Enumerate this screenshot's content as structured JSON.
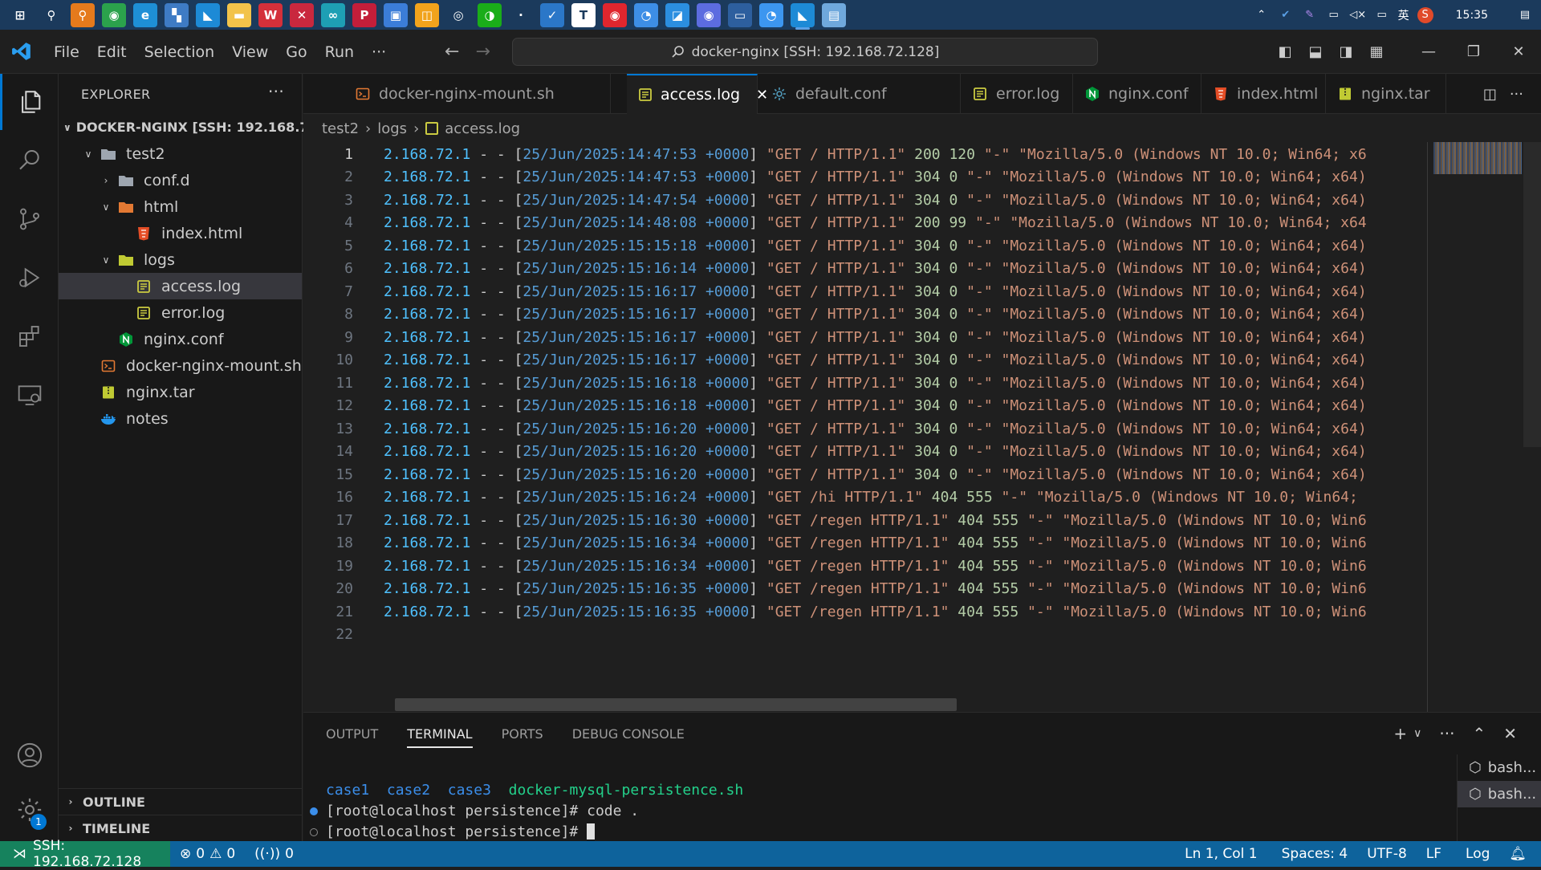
{
  "taskbar": {
    "apps": [
      {
        "icon": "windows-start-icon",
        "glyph": "⊞",
        "color": "#1b3a5c"
      },
      {
        "icon": "search-icon",
        "glyph": "⚲",
        "color": "#1b3a5c"
      },
      {
        "icon": "everything-search-icon",
        "glyph": "⚲",
        "color": "#e57a1c"
      },
      {
        "icon": "chrome-icon",
        "glyph": "◉",
        "color": "#2ba24c"
      },
      {
        "icon": "edge-icon",
        "glyph": "e",
        "color": "#1e8fd6"
      },
      {
        "icon": "vmware-icon",
        "glyph": "▚",
        "color": "#3e7bc4"
      },
      {
        "icon": "vscode-blue-icon",
        "glyph": "◣",
        "color": "#1d8ad6"
      },
      {
        "icon": "file-explorer-icon",
        "glyph": "▬",
        "color": "#f2c34a"
      },
      {
        "icon": "wps-icon",
        "glyph": "W",
        "color": "#d4303a"
      },
      {
        "icon": "xmind-icon",
        "glyph": "✕",
        "color": "#c9283e"
      },
      {
        "icon": "app-cyan-icon",
        "glyph": "∞",
        "color": "#1e9fb4"
      },
      {
        "icon": "pdf-icon",
        "glyph": "P",
        "color": "#c31e3a"
      },
      {
        "icon": "photos-icon",
        "glyph": "▣",
        "color": "#3b7dd8"
      },
      {
        "icon": "snipaste-icon",
        "glyph": "◫",
        "color": "#f1a31c"
      },
      {
        "icon": "steam-icon",
        "glyph": "◎",
        "color": "#1b3a5c"
      },
      {
        "icon": "wechat-icon",
        "glyph": "◑",
        "color": "#1aad19"
      },
      {
        "icon": "app-dark-icon",
        "glyph": "·",
        "color": "#1b3a5c"
      },
      {
        "icon": "app-blue-circle-icon",
        "glyph": "✓",
        "color": "#2b77c8"
      },
      {
        "icon": "typora-icon",
        "glyph": "T",
        "color": "#ffffff"
      },
      {
        "icon": "netease-music-icon",
        "glyph": "◉",
        "color": "#e0262e"
      },
      {
        "icon": "app-bird-icon",
        "glyph": "◔",
        "color": "#3d8ee6"
      },
      {
        "icon": "app-telegram-icon",
        "glyph": "◪",
        "color": "#2b8ee0"
      },
      {
        "icon": "app-purple-icon",
        "glyph": "◉",
        "color": "#5c6ce0"
      },
      {
        "icon": "app-window-icon",
        "glyph": "▭",
        "color": "#2d5f9e"
      },
      {
        "icon": "app-cloud-icon",
        "glyph": "◔",
        "color": "#3c96f0"
      },
      {
        "icon": "vscode-active-icon",
        "glyph": "◣",
        "color": "#1d8ad6"
      },
      {
        "icon": "notepad-icon",
        "glyph": "▤",
        "color": "#6fa8dc"
      }
    ],
    "tray": {
      "icons": [
        "chevron-up-icon",
        "app-check-icon",
        "pen-icon",
        "network-icon",
        "volume-muted-icon",
        "battery-icon"
      ],
      "input_method": "英",
      "clock": "15:35"
    }
  },
  "titlebar": {
    "menu": [
      "File",
      "Edit",
      "Selection",
      "View",
      "Go",
      "Run",
      "···"
    ],
    "command_center": "docker-nginx [SSH: 192.168.72.128]"
  },
  "sidebar": {
    "header": "EXPLORER",
    "root": "DOCKER-NGINX [SSH: 192.168.7...",
    "tree": [
      {
        "label": "test2",
        "depth": 1,
        "type": "folder-open"
      },
      {
        "label": "conf.d",
        "depth": 2,
        "type": "folder"
      },
      {
        "label": "html",
        "depth": 2,
        "type": "folder-open-html"
      },
      {
        "label": "index.html",
        "depth": 3,
        "type": "html"
      },
      {
        "label": "logs",
        "depth": 2,
        "type": "folder-open-logs"
      },
      {
        "label": "access.log",
        "depth": 3,
        "type": "log",
        "selected": true
      },
      {
        "label": "error.log",
        "depth": 3,
        "type": "log"
      },
      {
        "label": "nginx.conf",
        "depth": 2,
        "type": "nginx"
      },
      {
        "label": "docker-nginx-mount.sh",
        "depth": 1,
        "type": "shell"
      },
      {
        "label": "nginx.tar",
        "depth": 1,
        "type": "tar"
      },
      {
        "label": "notes",
        "depth": 1,
        "type": "docker"
      }
    ],
    "outline": "OUTLINE",
    "timeline": "TIMELINE"
  },
  "tabs": [
    {
      "label": "docker-nginx-mount.sh",
      "type": "shell"
    },
    {
      "label": "access.log",
      "type": "log",
      "active": true
    },
    {
      "label": "default.conf",
      "type": "conf"
    },
    {
      "label": "error.log",
      "type": "log"
    },
    {
      "label": "nginx.conf",
      "type": "nginx"
    },
    {
      "label": "index.html",
      "type": "html"
    },
    {
      "label": "nginx.tar",
      "type": "tar"
    }
  ],
  "breadcrumb": [
    "test2",
    "logs",
    "access.log"
  ],
  "editor": {
    "ip": "2.168.72.1",
    "lines": [
      {
        "n": 1,
        "ts": "25/Jun/2025:14:47:53",
        "req": "\"GET / HTTP/1.1\"",
        "status": "200",
        "size": "120",
        "rest": "\"-\" \"Mozilla/5.0 (Windows NT 10.0; Win64; x6"
      },
      {
        "n": 2,
        "ts": "25/Jun/2025:14:47:53",
        "req": "\"GET / HTTP/1.1\"",
        "status": "304",
        "size": "0",
        "rest": "\"-\" \"Mozilla/5.0 (Windows NT 10.0; Win64; x64)"
      },
      {
        "n": 3,
        "ts": "25/Jun/2025:14:47:54",
        "req": "\"GET / HTTP/1.1\"",
        "status": "304",
        "size": "0",
        "rest": "\"-\" \"Mozilla/5.0 (Windows NT 10.0; Win64; x64)"
      },
      {
        "n": 4,
        "ts": "25/Jun/2025:14:48:08",
        "req": "\"GET / HTTP/1.1\"",
        "status": "200",
        "size": "99",
        "rest": "\"-\" \"Mozilla/5.0 (Windows NT 10.0; Win64; x64"
      },
      {
        "n": 5,
        "ts": "25/Jun/2025:15:15:18",
        "req": "\"GET / HTTP/1.1\"",
        "status": "304",
        "size": "0",
        "rest": "\"-\" \"Mozilla/5.0 (Windows NT 10.0; Win64; x64)"
      },
      {
        "n": 6,
        "ts": "25/Jun/2025:15:16:14",
        "req": "\"GET / HTTP/1.1\"",
        "status": "304",
        "size": "0",
        "rest": "\"-\" \"Mozilla/5.0 (Windows NT 10.0; Win64; x64)"
      },
      {
        "n": 7,
        "ts": "25/Jun/2025:15:16:17",
        "req": "\"GET / HTTP/1.1\"",
        "status": "304",
        "size": "0",
        "rest": "\"-\" \"Mozilla/5.0 (Windows NT 10.0; Win64; x64)"
      },
      {
        "n": 8,
        "ts": "25/Jun/2025:15:16:17",
        "req": "\"GET / HTTP/1.1\"",
        "status": "304",
        "size": "0",
        "rest": "\"-\" \"Mozilla/5.0 (Windows NT 10.0; Win64; x64)"
      },
      {
        "n": 9,
        "ts": "25/Jun/2025:15:16:17",
        "req": "\"GET / HTTP/1.1\"",
        "status": "304",
        "size": "0",
        "rest": "\"-\" \"Mozilla/5.0 (Windows NT 10.0; Win64; x64)"
      },
      {
        "n": 10,
        "ts": "25/Jun/2025:15:16:17",
        "req": "\"GET / HTTP/1.1\"",
        "status": "304",
        "size": "0",
        "rest": "\"-\" \"Mozilla/5.0 (Windows NT 10.0; Win64; x64)"
      },
      {
        "n": 11,
        "ts": "25/Jun/2025:15:16:18",
        "req": "\"GET / HTTP/1.1\"",
        "status": "304",
        "size": "0",
        "rest": "\"-\" \"Mozilla/5.0 (Windows NT 10.0; Win64; x64)"
      },
      {
        "n": 12,
        "ts": "25/Jun/2025:15:16:18",
        "req": "\"GET / HTTP/1.1\"",
        "status": "304",
        "size": "0",
        "rest": "\"-\" \"Mozilla/5.0 (Windows NT 10.0; Win64; x64)"
      },
      {
        "n": 13,
        "ts": "25/Jun/2025:15:16:20",
        "req": "\"GET / HTTP/1.1\"",
        "status": "304",
        "size": "0",
        "rest": "\"-\" \"Mozilla/5.0 (Windows NT 10.0; Win64; x64)"
      },
      {
        "n": 14,
        "ts": "25/Jun/2025:15:16:20",
        "req": "\"GET / HTTP/1.1\"",
        "status": "304",
        "size": "0",
        "rest": "\"-\" \"Mozilla/5.0 (Windows NT 10.0; Win64; x64)"
      },
      {
        "n": 15,
        "ts": "25/Jun/2025:15:16:20",
        "req": "\"GET / HTTP/1.1\"",
        "status": "304",
        "size": "0",
        "rest": "\"-\" \"Mozilla/5.0 (Windows NT 10.0; Win64; x64)"
      },
      {
        "n": 16,
        "ts": "25/Jun/2025:15:16:24",
        "req": "\"GET /hi HTTP/1.1\"",
        "status": "404",
        "size": "555",
        "rest": "\"-\" \"Mozilla/5.0 (Windows NT 10.0; Win64;"
      },
      {
        "n": 17,
        "ts": "25/Jun/2025:15:16:30",
        "req": "\"GET /regen HTTP/1.1\"",
        "status": "404",
        "size": "555",
        "rest": "\"-\" \"Mozilla/5.0 (Windows NT 10.0; Win6"
      },
      {
        "n": 18,
        "ts": "25/Jun/2025:15:16:34",
        "req": "\"GET /regen HTTP/1.1\"",
        "status": "404",
        "size": "555",
        "rest": "\"-\" \"Mozilla/5.0 (Windows NT 10.0; Win6"
      },
      {
        "n": 19,
        "ts": "25/Jun/2025:15:16:34",
        "req": "\"GET /regen HTTP/1.1\"",
        "status": "404",
        "size": "555",
        "rest": "\"-\" \"Mozilla/5.0 (Windows NT 10.0; Win6"
      },
      {
        "n": 20,
        "ts": "25/Jun/2025:15:16:35",
        "req": "\"GET /regen HTTP/1.1\"",
        "status": "404",
        "size": "555",
        "rest": "\"-\" \"Mozilla/5.0 (Windows NT 10.0; Win6"
      },
      {
        "n": 21,
        "ts": "25/Jun/2025:15:16:35",
        "req": "\"GET /regen HTTP/1.1\"",
        "status": "404",
        "size": "555",
        "rest": "\"-\" \"Mozilla/5.0 (Windows NT 10.0; Win6"
      },
      {
        "n": 22,
        "ts": "",
        "req": "",
        "status": "",
        "size": "",
        "rest": ""
      }
    ],
    "tz": "+0000"
  },
  "panel": {
    "tabs": [
      "OUTPUT",
      "TERMINAL",
      "PORTS",
      "DEBUG CONSOLE"
    ],
    "active_tab": "TERMINAL",
    "terminal": {
      "ls_output": [
        "case1",
        "case2",
        "case3",
        "docker-mysql-persistence.sh"
      ],
      "prompt1": "[root@localhost persistence]# code .",
      "prompt2": "[root@localhost persistence]# "
    },
    "sessions": [
      "bash...",
      "bash..."
    ]
  },
  "statusbar": {
    "remote": "SSH: 192.168.72.128",
    "errors": "0",
    "warnings": "0",
    "ports": "0",
    "position": "Ln 1, Col 1",
    "spaces": "Spaces: 4",
    "encoding": "UTF-8",
    "eol": "LF",
    "language": "Log"
  },
  "badges": {
    "settings_count": "1"
  },
  "colors": {
    "accent": "#0078d4",
    "statusbar": "#0e639c",
    "remote": "#16825d"
  }
}
